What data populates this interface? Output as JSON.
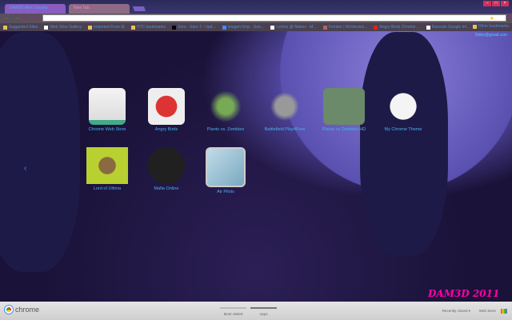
{
  "tabs": [
    {
      "label": "DAM3D Alien Swamp"
    },
    {
      "label": "New Tab"
    }
  ],
  "omnibox": {
    "value": ""
  },
  "bookmarks": [
    "Suggested Sites",
    "Web Slice Gallery",
    "Imported From IE",
    "HTC bookmarks",
    "Xero - Xero 7 - Upd...",
    "imagen hmp - Goo...",
    "Lennie @ Makes - M...",
    "Frontier | MsVersion...",
    "Angry Birds Chrome ...",
    "Barcode Google Inf..."
  ],
  "other_bookmarks": "Other bookmarks",
  "email": "f3ider@gmail.com",
  "apps": [
    {
      "label": "Chrome Web Store",
      "color": "#f0f0f0"
    },
    {
      "label": "Angry Birds",
      "color": "#d84040"
    },
    {
      "label": "Plants vs. Zombies",
      "color": "#6a8a3a"
    },
    {
      "label": "Battlefield Play4Free",
      "color": "#8a8a8a"
    },
    {
      "label": "Plants vs Zombies HD",
      "color": "#6a8a6a"
    },
    {
      "label": "My Chrome Theme",
      "color": "#f4f4f4"
    },
    {
      "label": "Lord of Ultima",
      "color": "#b8d030"
    },
    {
      "label": "Mafia Online",
      "color": "#202020"
    },
    {
      "label": "Air Pilots",
      "color": "#9ac4d8"
    }
  ],
  "signature": "DAM3D 2011",
  "footer": {
    "brand": "chrome",
    "most_visited": "Most visited",
    "apps": "Apps",
    "recently_closed": "Recently closed ▾",
    "web_store": "Web Store"
  }
}
